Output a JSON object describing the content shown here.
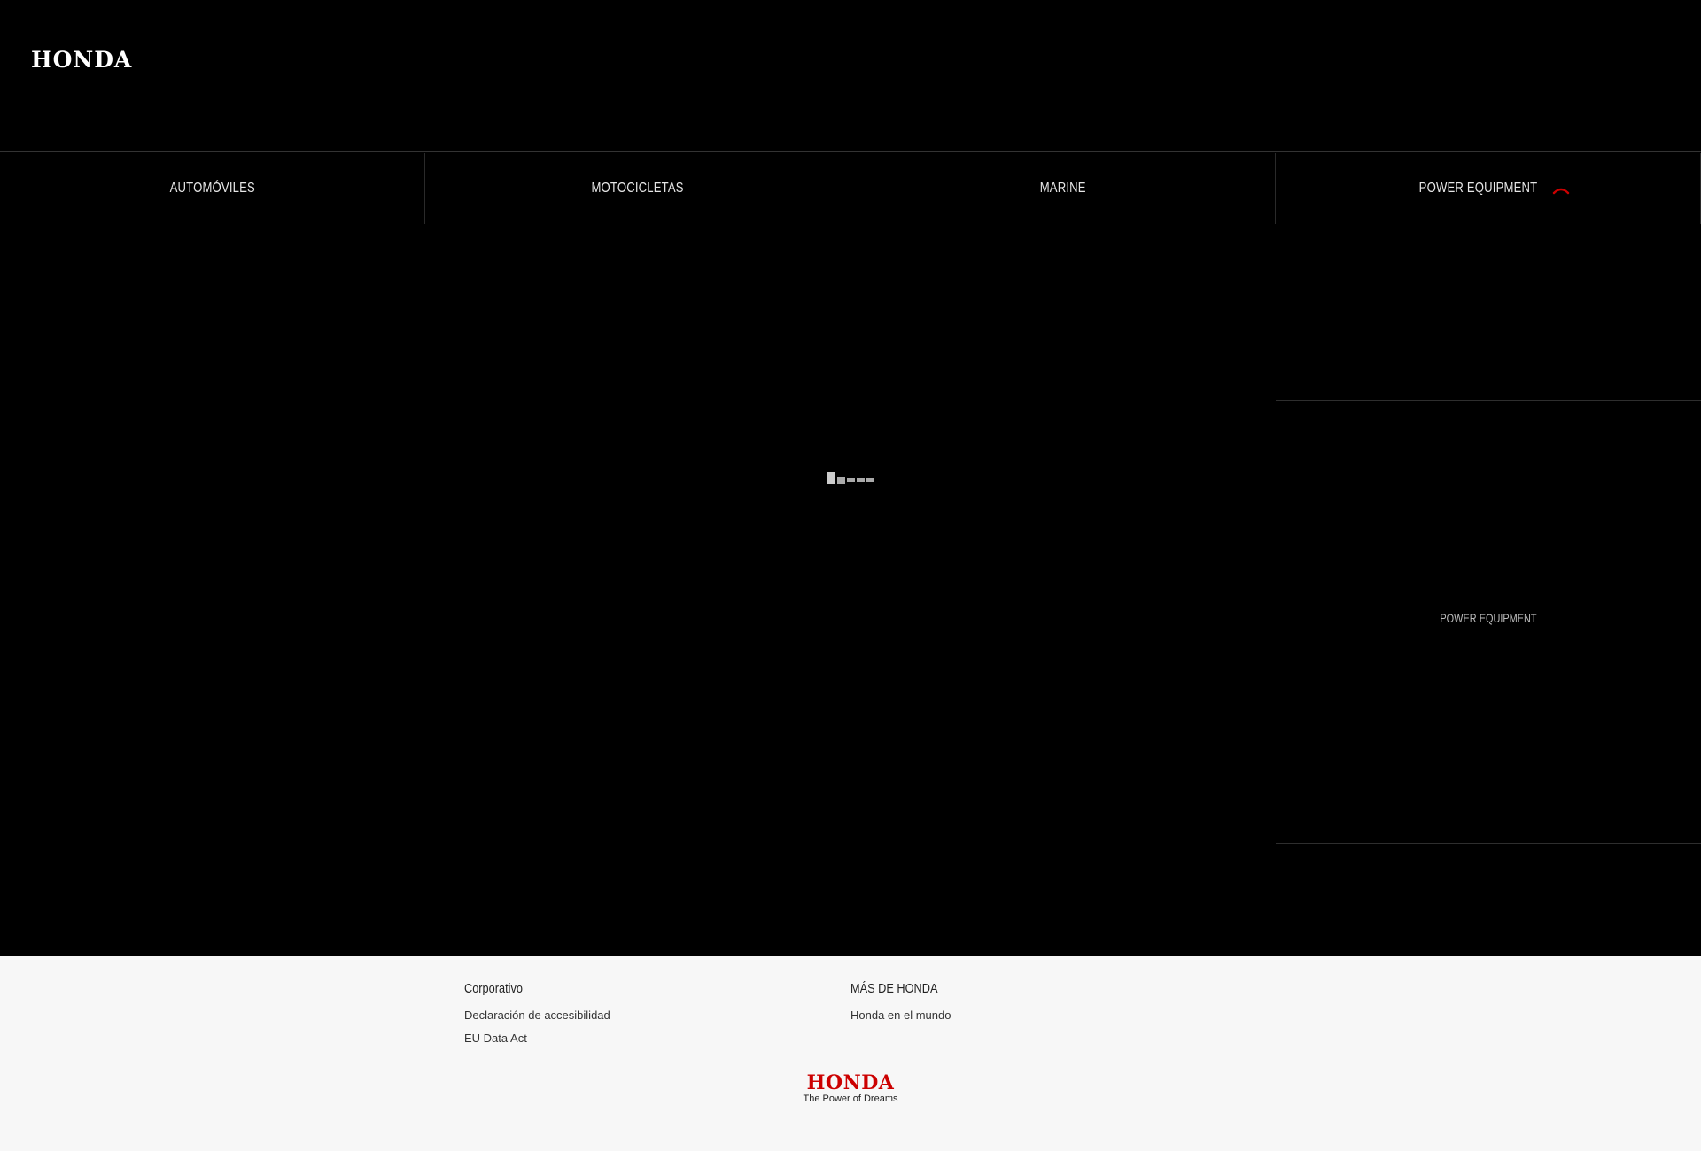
{
  "header": {
    "logo_text": "HONDA"
  },
  "nav": {
    "items": [
      {
        "label": "AUTOMÓVILES"
      },
      {
        "label": "MOTOCICLETAS"
      },
      {
        "label": "MARINE"
      },
      {
        "label": "POWER EQUIPMENT",
        "expanded": true
      }
    ],
    "chevron_icon": "chevron-up-icon",
    "accent_color": "#cc0000"
  },
  "dropdown": {
    "label": "POWER EQUIPMENT"
  },
  "footer": {
    "col1": {
      "heading": "Corporativo",
      "links": [
        "Declaración de accesibilidad",
        "EU Data Act"
      ]
    },
    "col2": {
      "heading": "MÁS DE HONDA",
      "links": [
        "Honda en el mundo"
      ]
    },
    "logo": {
      "brand": "HONDA",
      "tagline": "The Power of Dreams",
      "color": "#cc0000"
    }
  }
}
